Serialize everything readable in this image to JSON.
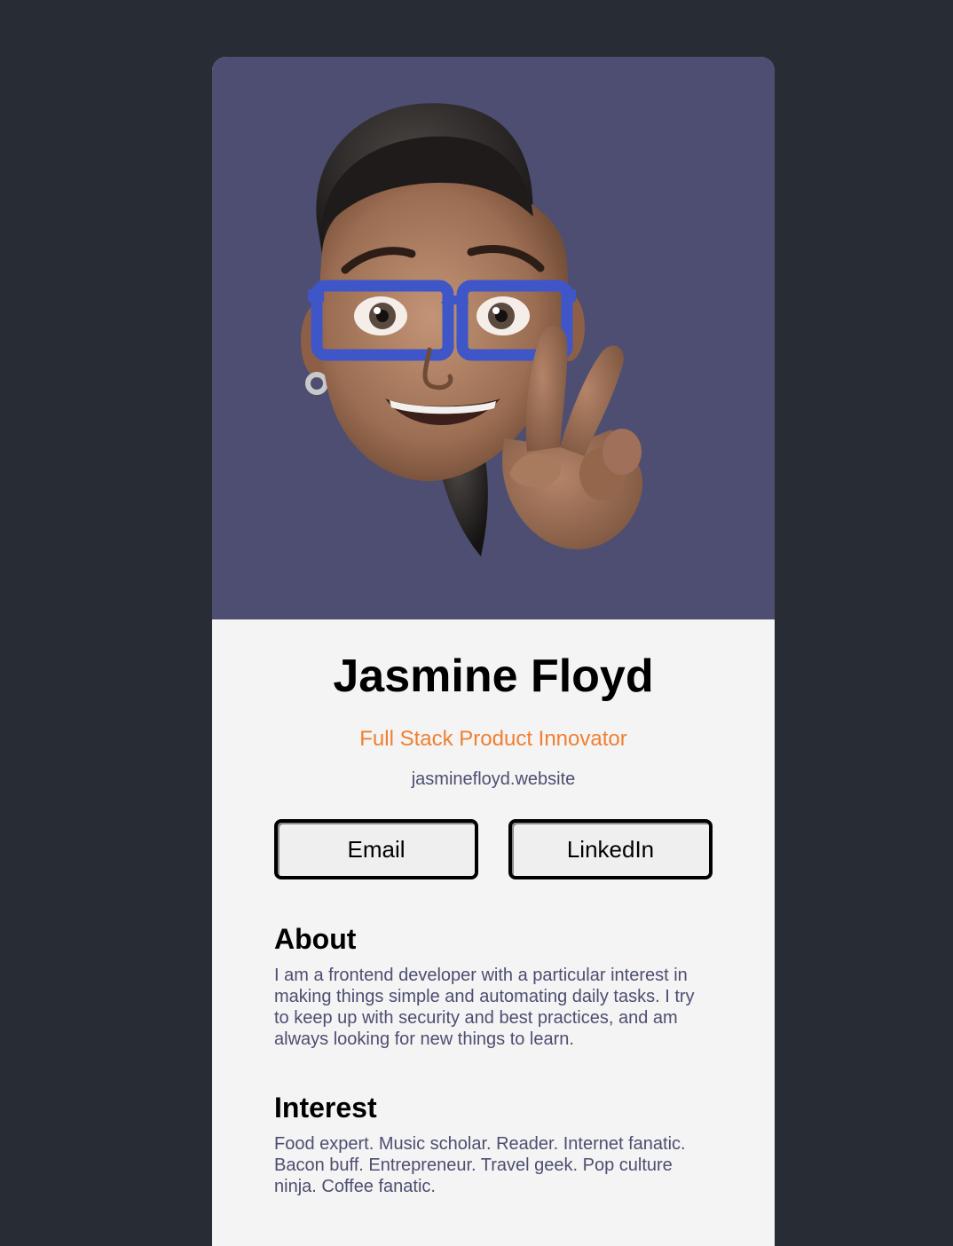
{
  "profile": {
    "name": "Jasmine Floyd",
    "title": "Full Stack Product Innovator",
    "website": "jasminefloyd.website"
  },
  "buttons": {
    "email": "Email",
    "linkedin": "LinkedIn"
  },
  "about": {
    "heading": "About",
    "text": "I am a frontend developer with a particular interest in making things simple and automating daily tasks. I try to keep up with security and best practices, and am always looking for new things to learn."
  },
  "interest": {
    "heading": "Interest",
    "text": "Food expert. Music scholar. Reader. Internet fanatic. Bacon buff. Entrepreneur. Travel geek. Pop culture ninja. Coffee fanatic."
  },
  "colors": {
    "page_background": "#282c34",
    "card_background": "#f4f4f4",
    "hero_background": "#4d4e71",
    "accent": "#f07f30",
    "body_text": "#4d4e71"
  },
  "icons": {
    "avatar": "memoji-avatar-peace-sign"
  }
}
